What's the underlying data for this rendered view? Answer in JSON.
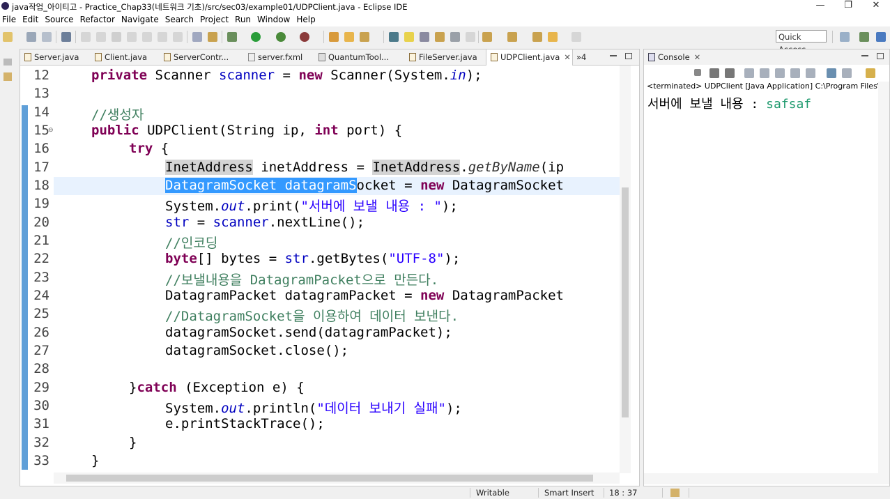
{
  "window": {
    "title": "java작업_아이티고 - Practice_Chap33(네트워크 기초)/src/sec03/example01/UDPClient.java - Eclipse IDE",
    "minimize": "—",
    "maximize": "❐",
    "close": "✕"
  },
  "menu": [
    "File",
    "Edit",
    "Source",
    "Refactor",
    "Navigate",
    "Search",
    "Project",
    "Run",
    "Window",
    "Help"
  ],
  "quick_access": {
    "placeholder": "Quick Access"
  },
  "editor": {
    "tabs": [
      {
        "label": "Server.java"
      },
      {
        "label": "Client.java"
      },
      {
        "label": "ServerContr..."
      },
      {
        "label": "server.fxml"
      },
      {
        "label": "QuantumTool..."
      },
      {
        "label": "FileServer.java"
      },
      {
        "label": "UDPClient.java",
        "close": "✕"
      }
    ],
    "overflow": "»4",
    "line_numbers": [
      "12",
      "13",
      "14",
      "15",
      "16",
      "17",
      "18",
      "19",
      "20",
      "21",
      "22",
      "23",
      "24",
      "25",
      "26",
      "27",
      "28",
      "29",
      "30",
      "31",
      "32",
      "33"
    ],
    "fold_marker": "⊖",
    "code": {
      "l12": [
        "private",
        " Scanner ",
        "scanner",
        " = ",
        "new",
        " Scanner(System.",
        "in",
        ");"
      ],
      "l14": "//생성자",
      "l15": [
        "public",
        " UDPClient(String ip, ",
        "int",
        " port) {"
      ],
      "l16": [
        "try",
        " {"
      ],
      "l17": [
        "InetAddress",
        " inetAddress = ",
        "InetAddress",
        ".",
        "getByName",
        "(ip"
      ],
      "l18": [
        "DatagramSocket datagramS",
        "ocket = ",
        "new",
        " DatagramSocket"
      ],
      "l19": [
        "System.",
        "out",
        ".print(",
        "\"서버에 보낼 내용 : \"",
        ");"
      ],
      "l20": [
        "str",
        " = ",
        "scanner",
        ".nextLine();"
      ],
      "l21": "//인코딩",
      "l22": [
        "byte",
        "[] bytes = ",
        "str",
        ".getBytes(",
        "\"UTF-8\"",
        ");"
      ],
      "l23": "//보낼내용을 DatagramPacket으로 만든다.",
      "l24": "DatagramPacket datagramPacket = new DatagramPacket",
      "l24b": [
        "DatagramPacket datagramPacket = ",
        "new",
        " DatagramPacket"
      ],
      "l25": "//DatagramSocket을 이용하여 데이터 보낸다.",
      "l26": "datagramSocket.send(datagramPacket);",
      "l27": "datagramSocket.close();",
      "l29": [
        "}",
        "catch",
        " (Exception e) {"
      ],
      "l30": [
        "System.",
        "out",
        ".println(",
        "\"데이터 보내기 실패\"",
        ");"
      ],
      "l31": "e.printStackTrace();",
      "l32": "}",
      "l33": "}"
    }
  },
  "console": {
    "tab_label": "Console",
    "tab_close": "✕",
    "status": "<terminated> UDPClient [Java Application] C:\\Program Files\\Java\\j",
    "output_prompt": "서버에 보낼 내용 : ",
    "output_input": "safsaf"
  },
  "statusbar": {
    "writable": "Writable",
    "insert_mode": "Smart Insert",
    "position": "18 : 37"
  }
}
